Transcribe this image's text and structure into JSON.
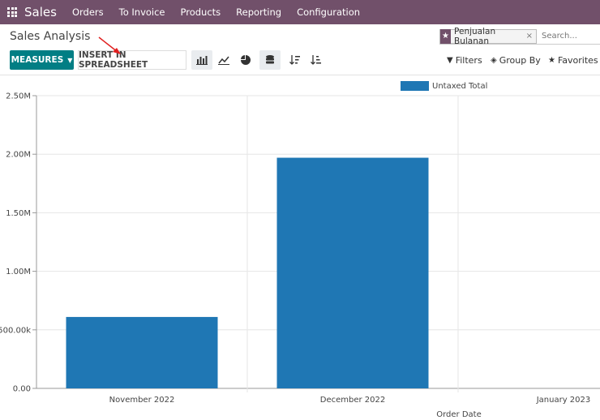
{
  "navbar": {
    "brand": "Sales",
    "items": [
      "Orders",
      "To Invoice",
      "Products",
      "Reporting",
      "Configuration"
    ]
  },
  "page": {
    "title": "Sales Analysis"
  },
  "search": {
    "facet_label": "Penjualan Bulanan",
    "facet_close": "×",
    "placeholder": "Search..."
  },
  "toolbar": {
    "measures_label": "MEASURES",
    "insert_label": "INSERT IN SPREADSHEET",
    "filters_label": "Filters",
    "groupby_label": "Group By",
    "favorites_label": "Favorites"
  },
  "colors": {
    "navbar": "#71506a",
    "primary": "#017e84",
    "bar": "#1f77b4"
  },
  "chart_data": {
    "type": "bar",
    "categories": [
      "November 2022",
      "December 2022",
      "January 2023"
    ],
    "series": [
      {
        "name": "Untaxed Total",
        "values": [
          610000,
          1970000,
          0
        ]
      }
    ],
    "xlabel": "Order Date",
    "ylabel": "",
    "ylim": [
      0,
      2500000
    ],
    "yticks": [
      0,
      500000,
      1000000,
      1500000,
      2000000,
      2500000
    ],
    "ytick_labels": [
      "0.00",
      "500.00k",
      "1.00M",
      "1.50M",
      "2.00M",
      "2.50M"
    ],
    "grid": true,
    "legend": "top-center"
  }
}
